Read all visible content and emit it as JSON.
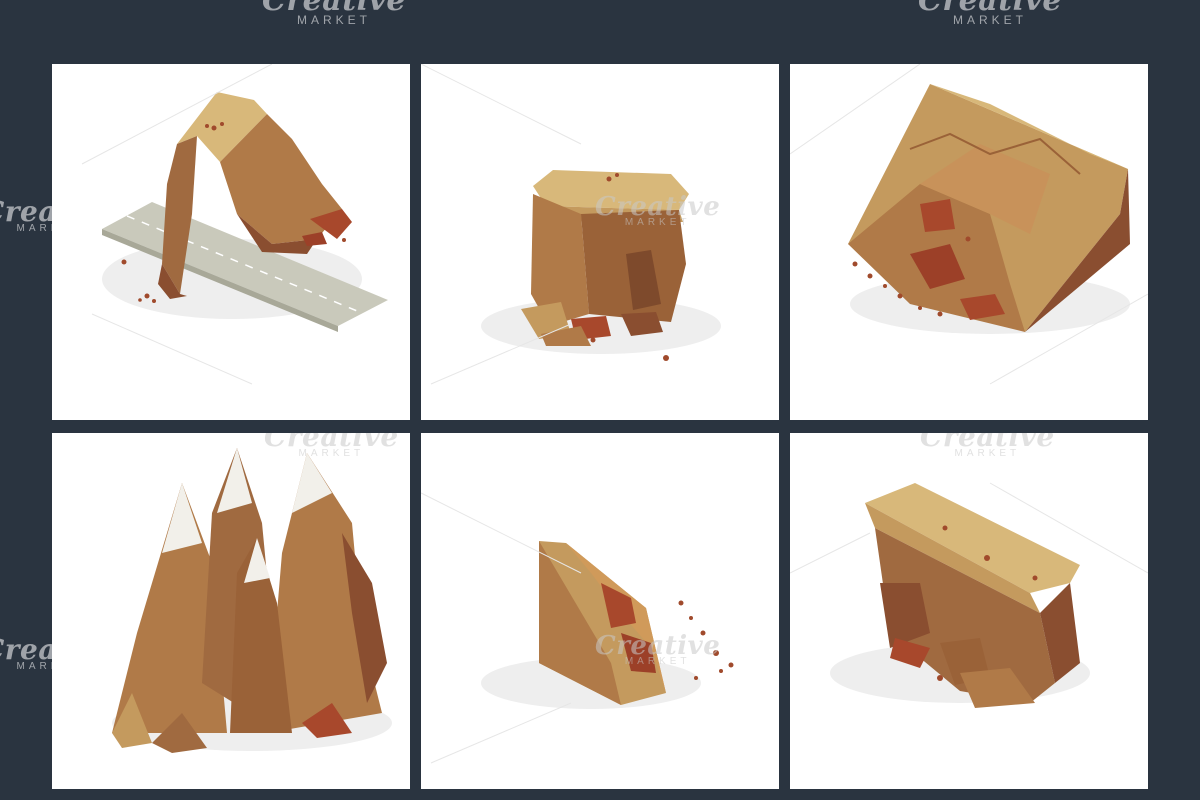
{
  "watermark": {
    "brand": "Creative",
    "market": "MARKET"
  },
  "colors": {
    "background": "#2a3440",
    "tile": "#ffffff",
    "rock_light": "#d8b87a",
    "rock_mid": "#b07a48",
    "rock_dark": "#8a4e30",
    "road": "#c8c8b8",
    "snow": "#f2f0ea"
  },
  "tiles": [
    {
      "subject": "rock-arch-over-road"
    },
    {
      "subject": "mesa-pillar"
    },
    {
      "subject": "cliff-slope-with-rubble"
    },
    {
      "subject": "snow-capped-peaks"
    },
    {
      "subject": "landslide-wedge"
    },
    {
      "subject": "cliff-ledge"
    }
  ]
}
